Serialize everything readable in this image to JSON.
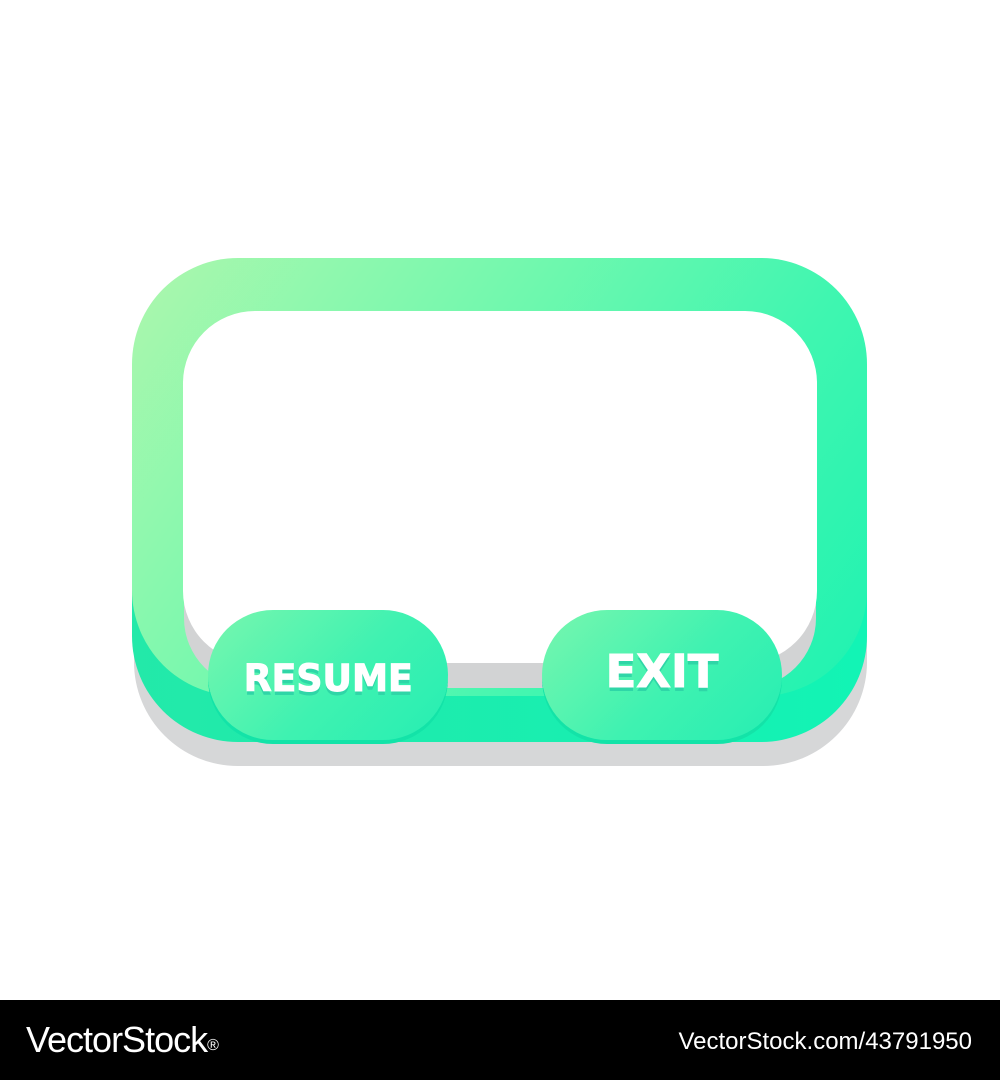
{
  "dialog": {
    "buttons": {
      "resume_label": "RESUME",
      "exit_label": "EXIT"
    },
    "colors": {
      "frame_light": "#aef7ad",
      "frame_dark": "#12f4b5",
      "shadow": "#d6d7d8",
      "button_text": "#ffffff"
    }
  },
  "footer": {
    "brand": "VectorStock",
    "brand_mark": "®",
    "credit": "VectorStock.com/43791950"
  }
}
